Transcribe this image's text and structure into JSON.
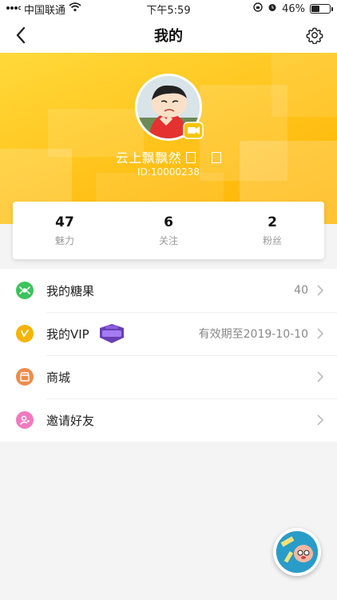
{
  "status": {
    "carrier": "中国联通",
    "time": "下午5:59",
    "battery": "46%",
    "battery_level": 0.46
  },
  "nav": {
    "title": "我的"
  },
  "profile": {
    "nickname": "云上飘飘然",
    "user_id": "ID:10000238"
  },
  "stats": [
    {
      "value": "47",
      "label": "魅力"
    },
    {
      "value": "6",
      "label": "关注"
    },
    {
      "value": "2",
      "label": "粉丝"
    }
  ],
  "menu": [
    {
      "label": "我的糖果",
      "value": "40",
      "icon": "candy-icon",
      "color": "#3cc35b"
    },
    {
      "label": "我的VIP",
      "value": "有效期至2019-10-10",
      "icon": "vip-icon",
      "color": "#f5b400"
    },
    {
      "label": "商城",
      "value": "",
      "icon": "shop-icon",
      "color": "#f08a4b"
    },
    {
      "label": "邀请好友",
      "value": "",
      "icon": "invite-friend-icon",
      "color": "#f07ac0"
    }
  ],
  "colors": {
    "hero": "#ffc21a",
    "accent": "#ffb300"
  }
}
